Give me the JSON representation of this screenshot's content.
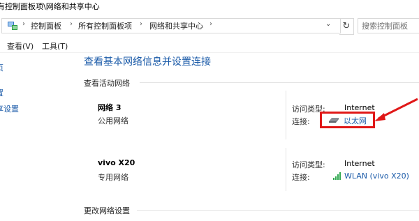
{
  "window": {
    "title": "有控制面板项\\网络和共享中心"
  },
  "address_bar": {
    "breadcrumb": [
      "控制面板",
      "所有控制面板项",
      "网络和共享中心"
    ],
    "separator": "›",
    "dropdown": "⌄",
    "refresh": "↻",
    "search_placeholder": "搜索控制面板"
  },
  "menu": {
    "items": [
      "查看(V)",
      "工具(T)"
    ]
  },
  "left_pane": {
    "links": [
      "页",
      "置",
      "享设置"
    ]
  },
  "main": {
    "title": "查看基本网络信息并设置连接",
    "active_networks_heading": "查看活动网络",
    "change_settings_heading": "更改网络设置",
    "networks": [
      {
        "name": "网络 3",
        "type": "公用网络",
        "access_label": "访问类型:",
        "access_value": "Internet",
        "connection_label": "连接:",
        "connection_value": "以太网",
        "connection_icon": "ethernet-icon"
      },
      {
        "name": "vivo X20",
        "type": "专用网络",
        "access_label": "访问类型:",
        "access_value": "Internet",
        "connection_label": "连接:",
        "connection_value": "WLAN (vivo X20)",
        "connection_icon": "wifi-signal-icon"
      }
    ]
  },
  "colors": {
    "link": "#1a5aa8",
    "highlight": "#e01818",
    "wifi": "#2fa84f"
  }
}
